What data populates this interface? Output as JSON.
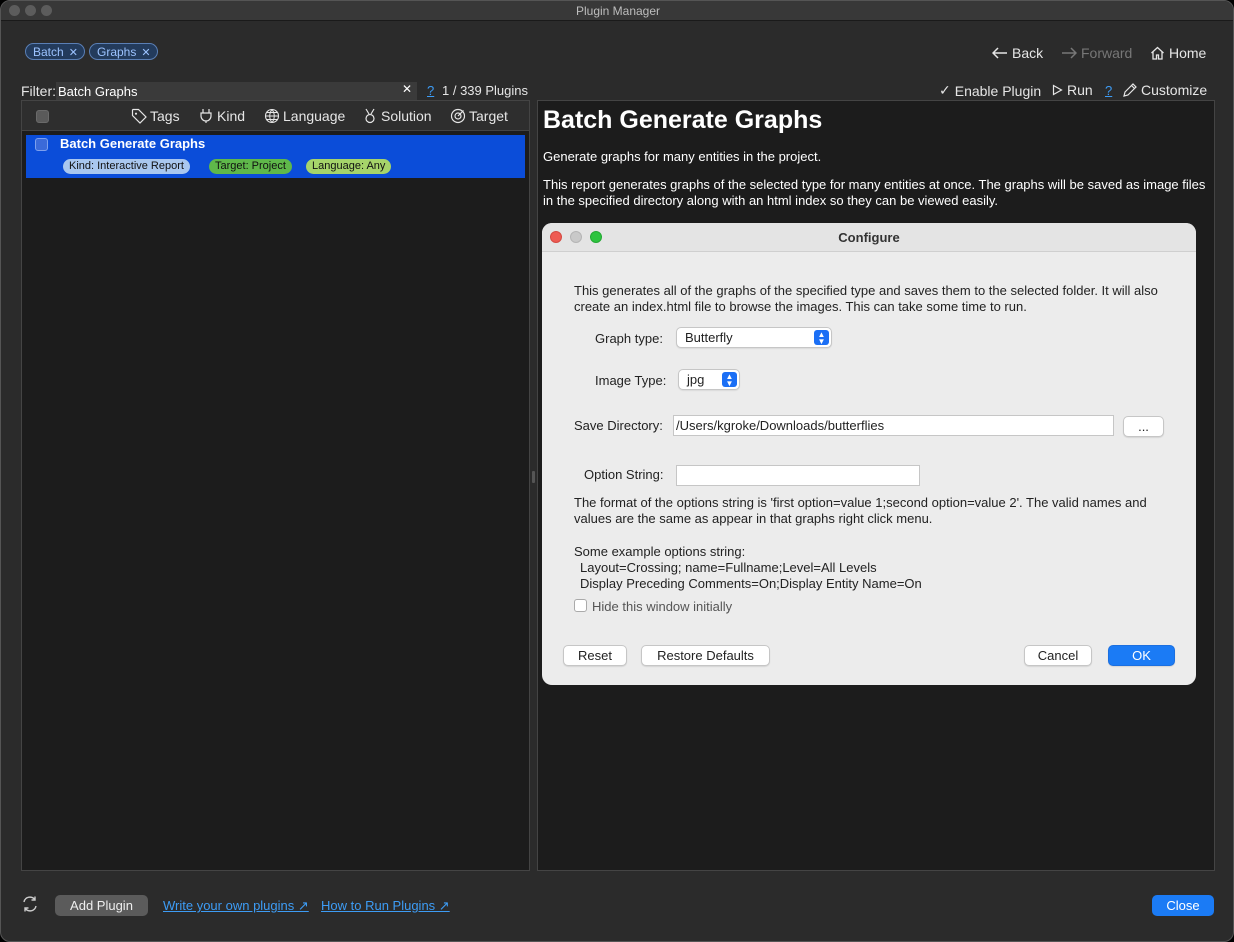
{
  "window": {
    "title": "Plugin Manager"
  },
  "filter_tags": [
    {
      "label": "Batch"
    },
    {
      "label": "Graphs"
    }
  ],
  "nav": {
    "back": "Back",
    "forward": "Forward",
    "home": "Home"
  },
  "filter": {
    "label": "Filter:",
    "value": "Batch Graphs",
    "help": "?",
    "count": "1 / 339 Plugins"
  },
  "actions": {
    "enable": "Enable Plugin",
    "run": "Run",
    "help": "?",
    "customize": "Customize"
  },
  "columns": [
    "Tags",
    "Kind",
    "Language",
    "Solution",
    "Target"
  ],
  "plugins": [
    {
      "name": "Batch Generate Graphs",
      "kind": "Kind: Interactive Report",
      "target": "Target: Project",
      "language": "Language: Any"
    }
  ],
  "detail": {
    "title": "Batch Generate Graphs",
    "summary": "Generate graphs for many entities in the project.",
    "description": "This report generates graphs of the selected type for many entities at once. The graphs will be saved as image files in the specified directory along with an html index so they can be viewed easily."
  },
  "dialog": {
    "title": "Configure",
    "intro": "This generates all of the graphs of the specified type and saves them to the selected folder. It will also create an index.html file to browse the images. This can take some time to run.",
    "graph_type_label": "Graph type:",
    "graph_type_value": "Butterfly",
    "image_type_label": "Image Type:",
    "image_type_value": "jpg",
    "save_dir_label": "Save Directory:",
    "save_dir_value": "/Users/kgroke/Downloads/butterflies",
    "browse_label": "...",
    "option_label": "Option String:",
    "option_value": "",
    "format_help": "The format of the options string is 'first option=value 1;second option=value 2'. The valid names and values are the same as appear in that graphs right click menu.",
    "example_heading": "Some example options string:",
    "example_1": "Layout=Crossing; name=Fullname;Level=All Levels",
    "example_2": "Display Preceding Comments=On;Display Entity Name=On",
    "hide_label": "Hide this window initially",
    "reset": "Reset",
    "restore": "Restore Defaults",
    "cancel": "Cancel",
    "ok": "OK"
  },
  "footer": {
    "add_plugin": "Add Plugin",
    "link_write": "Write your own plugins ↗",
    "link_run": "How to Run Plugins ↗",
    "close": "Close"
  },
  "colors": {
    "accent": "#1b7bf5",
    "selection": "#0b4dd9",
    "badge_kind": "#a9c7ef",
    "badge_target": "#5fb84a",
    "badge_language": "#a6d46a"
  }
}
